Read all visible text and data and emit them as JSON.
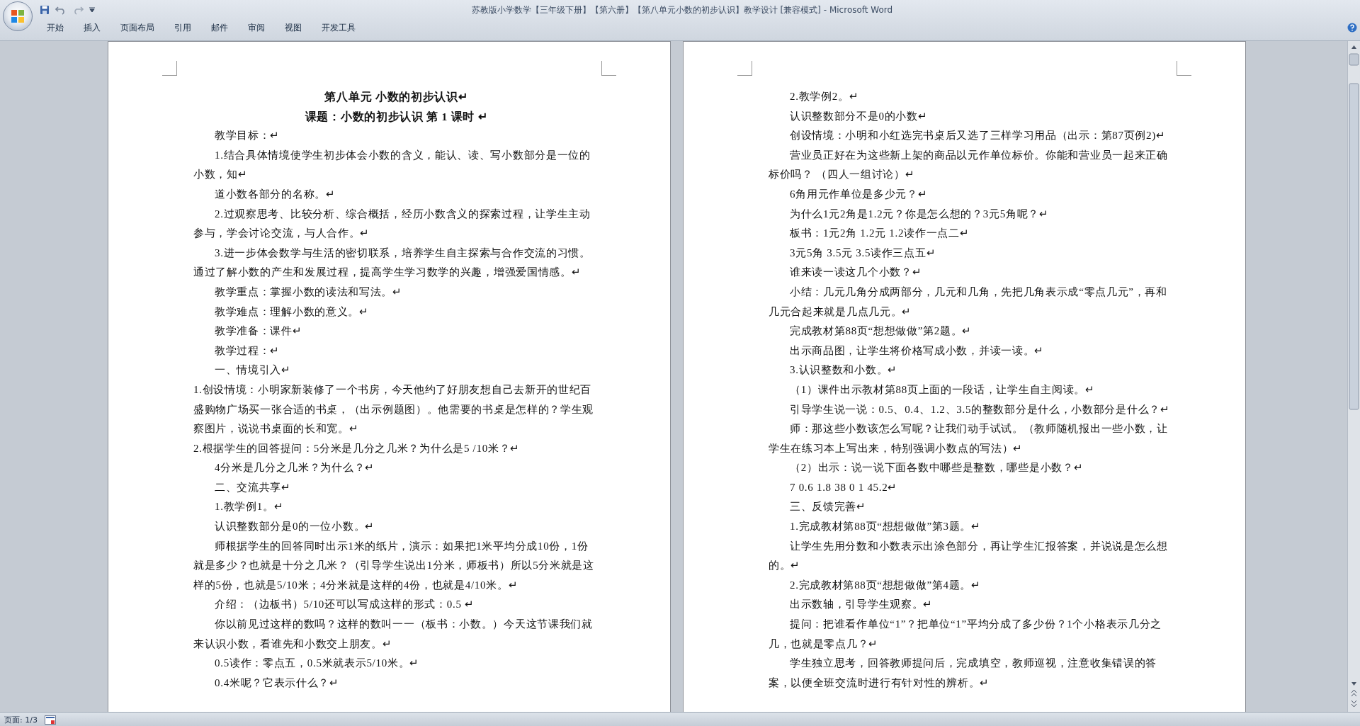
{
  "window": {
    "title": "苏教版小学数学【三年级下册】【第六册】【第八单元小数的初步认识】教学设计 [兼容模式] - Microsoft Word"
  },
  "ribbon_tabs": [
    {
      "label": "开始"
    },
    {
      "label": "插入"
    },
    {
      "label": "页面布局"
    },
    {
      "label": "引用"
    },
    {
      "label": "邮件"
    },
    {
      "label": "审阅"
    },
    {
      "label": "视图"
    },
    {
      "label": "开发工具"
    }
  ],
  "pages": [
    {
      "paragraphs": [
        {
          "kind": "heading",
          "text": "第八单元  小数的初步认识↵"
        },
        {
          "kind": "subtitle",
          "text": "课题：小数的初步认识  第  1  课时  ↵"
        },
        {
          "kind": "indent",
          "text": "教学目标：↵"
        },
        {
          "kind": "indent",
          "text": "1.结合具体情境使学生初步体会小数的含义，能认、读、写小数部分是一位的小数，知↵"
        },
        {
          "kind": "indent",
          "text": "道小数各部分的名称。↵"
        },
        {
          "kind": "indent",
          "text": "2.过观察思考、比较分析、综合概括，经历小数含义的探索过程，让学生主动参与，学会讨论交流，与人合作。↵"
        },
        {
          "kind": "indent",
          "text": "3.进一步体会数学与生活的密切联系，培养学生自主探索与合作交流的习惯。通过了解小数的产生和发展过程，提高学生学习数学的兴趣，增强爱国情感。↵"
        },
        {
          "kind": "indent",
          "text": "教学重点：掌握小数的读法和写法。↵"
        },
        {
          "kind": "indent",
          "text": "教学难点：理解小数的意义。↵"
        },
        {
          "kind": "indent",
          "text": "教学准备：课件↵"
        },
        {
          "kind": "indent",
          "text": "教学过程：↵"
        },
        {
          "kind": "indent",
          "text": "一、情境引入↵"
        },
        {
          "kind": "flush",
          "text": "1.创设情境：小明家新装修了一个书房，今天他约了好朋友想自己去新开的世纪百盛购物广场买一张合适的书桌，（出示例题图）。他需要的书桌是怎样的？学生观察图片，说说书桌面的长和宽。↵"
        },
        {
          "kind": "flush",
          "text": "2.根据学生的回答提问：5分米是几分之几米？为什么是5 /10米？↵"
        },
        {
          "kind": "indent",
          "text": "4分米是几分之几米？为什么？↵"
        },
        {
          "kind": "indent",
          "text": "二、交流共享↵"
        },
        {
          "kind": "indent",
          "text": "1.教学例1。↵"
        },
        {
          "kind": "indent",
          "text": "认识整数部分是0的一位小数。↵"
        },
        {
          "kind": "indent",
          "text": "师根据学生的回答同时出示1米的纸片，演示：如果把1米平均分成10份，1份就是多少？也就是十分之几米？（引导学生说出1分米，师板书）所以5分米就是这样的5份，也就是5/10米；4分米就是这样的4份，也就是4/10米。↵"
        },
        {
          "kind": "indent",
          "text": "介绍：（边板书）5/10还可以写成这样的形式：0.5 ↵"
        },
        {
          "kind": "indent",
          "text": "你以前见过这样的数吗？这样的数叫一一（板书：小数。）今天这节课我们就来认识小数，看谁先和小数交上朋友。↵"
        },
        {
          "kind": "indent",
          "text": "0.5读作：零点五，0.5米就表示5/10米。↵"
        },
        {
          "kind": "indent",
          "text": "0.4米呢？它表示什么？↵"
        }
      ]
    },
    {
      "paragraphs": [
        {
          "kind": "indent",
          "text": "2.教学例2。↵"
        },
        {
          "kind": "indent",
          "text": "认识整数部分不是0的小数↵"
        },
        {
          "kind": "indent",
          "text": "创设情境：小明和小红选完书桌后又选了三样学习用品（出示：第87页例2)↵"
        },
        {
          "kind": "indent",
          "text": "营业员正好在为这些新上架的商品以元作单位标价。你能和营业员一起来正确标价吗？    （四人一组讨论）↵"
        },
        {
          "kind": "indent",
          "text": "6角用元作单位是多少元？↵"
        },
        {
          "kind": "indent",
          "text": "为什么1元2角是1.2元？你是怎么想的？3元5角呢？↵"
        },
        {
          "kind": "indent",
          "text": "板书：1元2角  1.2元  1.2读作一点二↵"
        },
        {
          "kind": "indent",
          "text": "3元5角  3.5元  3.5读作三点五↵"
        },
        {
          "kind": "indent",
          "text": "谁来读一读这几个小数？↵"
        },
        {
          "kind": "indent",
          "text": "小结：几元几角分成两部分，几元和几角，先把几角表示成“零点几元”，再和几元合起来就是几点几元。↵"
        },
        {
          "kind": "indent",
          "text": "完成教材第88页“想想做做”第2题。↵"
        },
        {
          "kind": "indent",
          "text": "出示商品图，让学生将价格写成小数，并读一读。↵"
        },
        {
          "kind": "indent",
          "text": "3.认识整数和小数。↵"
        },
        {
          "kind": "indent",
          "text": "（1）课件出示教材第88页上面的一段话，让学生自主阅读。↵"
        },
        {
          "kind": "indent",
          "text": "引导学生说一说：0.5、0.4、1.2、3.5的整数部分是什么，小数部分是什么？↵"
        },
        {
          "kind": "indent",
          "text": "师：那这些小数该怎么写呢？让我们动手试试。（教师随机报出一些小数，让学生在练习本上写出来，特别强调小数点的写法）↵"
        },
        {
          "kind": "indent",
          "text": "（2）出示：说一说下面各数中哪些是整数，哪些是小数？↵"
        },
        {
          "kind": "indent",
          "text": "7 0.6 1.8 38 0 1  45.2↵"
        },
        {
          "kind": "indent",
          "text": "三、反馈完善↵"
        },
        {
          "kind": "indent",
          "text": "1.完成教材第88页“想想做做”第3题。↵"
        },
        {
          "kind": "indent",
          "text": "让学生先用分数和小数表示出涂色部分，再让学生汇报答案，并说说是怎么想的。↵"
        },
        {
          "kind": "indent",
          "text": "2.完成教材第88页“想想做做”第4题。↵"
        },
        {
          "kind": "indent",
          "text": "出示数轴，引导学生观察。↵"
        },
        {
          "kind": "indent",
          "text": "提问：把谁看作单位“1”？把单位“1”平均分成了多少份？1个小格表示几分之几，也就是零点几？↵"
        },
        {
          "kind": "indent",
          "text": "学生独立思考，回答教师提问后，完成填空，教师巡视，注意收集错误的答案，以便全班交流时进行有针对性的辨析。↵"
        }
      ]
    }
  ],
  "status_bar": {
    "page": "页面: 1/3"
  }
}
